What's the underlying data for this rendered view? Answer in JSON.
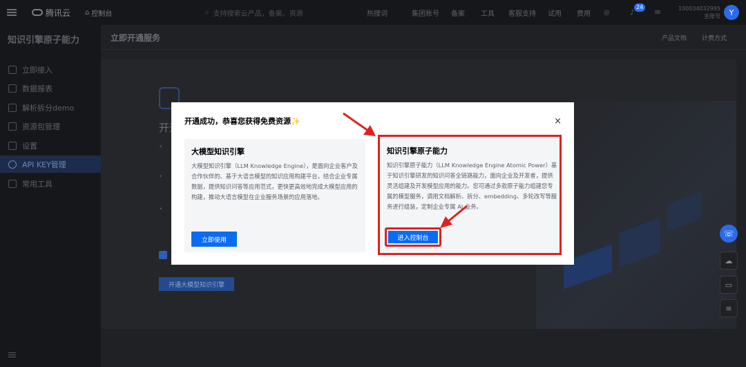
{
  "topnav": {
    "logo": "腾讯云",
    "console": "控制台",
    "search_placeholder": "支持搜索云产品，备案、资源",
    "items": [
      "热搜词",
      "集团账号",
      "备案",
      "工具",
      "客服支持",
      "试用",
      "费用"
    ],
    "notification_count": "24",
    "account_id": "100034032995",
    "account_type": "主账号",
    "avatar_letter": "Y"
  },
  "sidebar": {
    "title": "知识引擎原子能力",
    "items": [
      {
        "label": "立即接入"
      },
      {
        "label": "数据报表"
      },
      {
        "label": "解析拆分demo"
      },
      {
        "label": "资源包管理"
      },
      {
        "label": "设置"
      },
      {
        "label": "API KEY管理"
      },
      {
        "label": "常用工具"
      }
    ]
  },
  "main": {
    "title": "立即开通服务",
    "links": [
      "产品文档",
      "计费方式"
    ],
    "bg_heading": "开通",
    "bg_button": "开通大模型知识引擎"
  },
  "modal": {
    "title": "开通成功，恭喜您获得免费资源✨",
    "close": "×",
    "cards": [
      {
        "title": "大模型知识引擎",
        "description": "大模型知识引擎（LLM Knowledge Engine），是面向企业客户及合作伙伴的、基于大语言模型的知识应用构建平台，结合企业专属数据，提供知识问答等应用范式，更快更高效地完成大模型应用的构建，推动大语言模型在企业服务场景的应用落地。",
        "button": "立即使用"
      },
      {
        "title": "知识引擎原子能力",
        "description": "知识引擎原子能力（LLM Knowledge Engine Atomic Power）基于知识引擎研发的知识问答全链路能力，面向企业及开发者，提供灵活组建及开发模型应用的能力。您可通过多款原子能力组建您专属的模型服务，调用文档解析、拆分、embedding、多轮改写等服务进行组装，定制企业专属 AI 业务。",
        "button": "进入控制台"
      }
    ]
  },
  "colors": {
    "primary": "#0a6cf2",
    "highlight": "#e02020"
  }
}
